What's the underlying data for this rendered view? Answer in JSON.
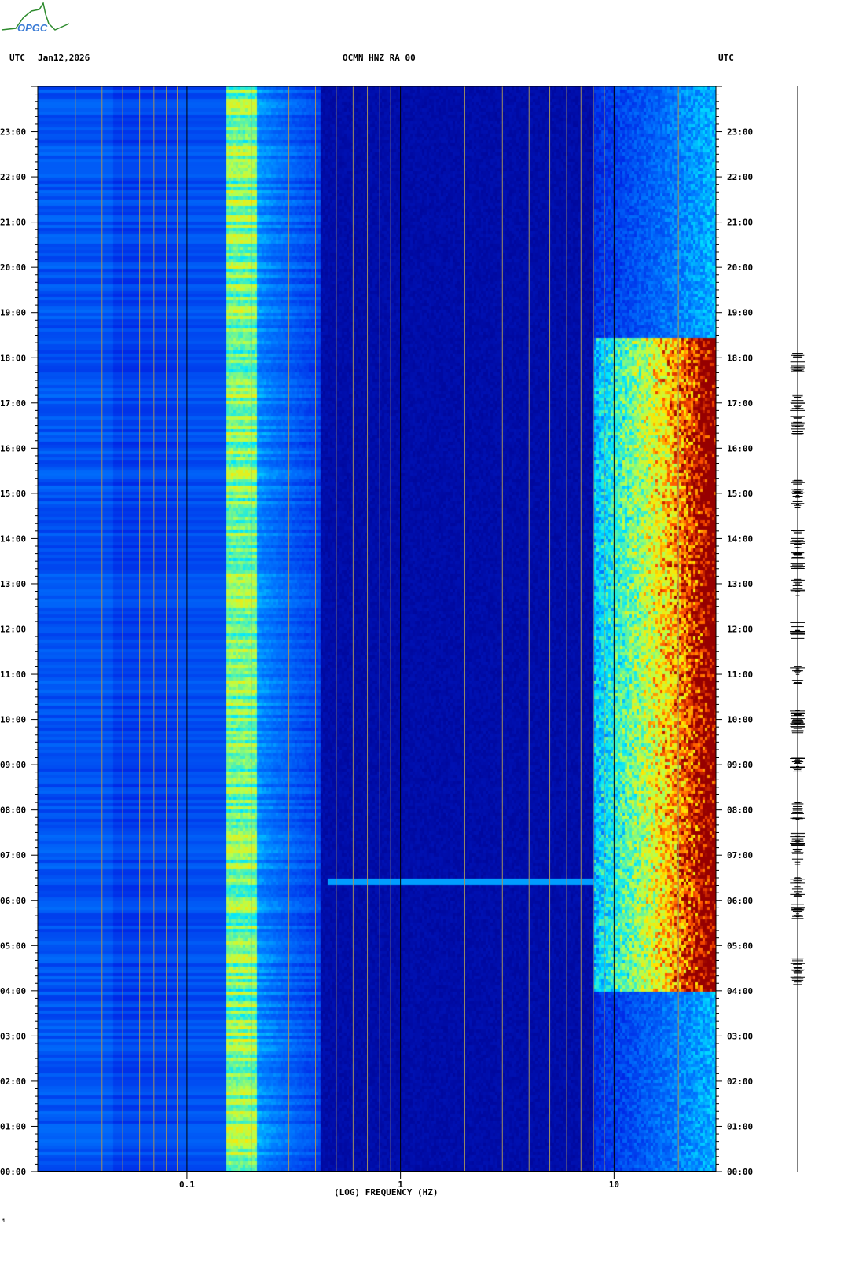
{
  "header": {
    "logo_text": "OPGC",
    "left_label": "UTC",
    "date": "Jan12,2026",
    "station": "OCMN HNZ RA 00",
    "right_label": "UTC"
  },
  "footer_mark": "M",
  "colors": {
    "low": "#00008c",
    "mid": "#0040ff",
    "cyan": "#00ffff",
    "yellow": "#ffff00",
    "red": "#a00000"
  },
  "chart_data": {
    "type": "heatmap",
    "title": "OCMN HNZ RA 00",
    "xlabel": "(LOG) FREQUENCY (HZ)",
    "ylabel": "UTC",
    "xscale": "log",
    "xlim": [
      0.02,
      30
    ],
    "ylim_hours": [
      0,
      24
    ],
    "xticks": [
      {
        "value": 0.1,
        "label": "0.1"
      },
      {
        "value": 1,
        "label": "1"
      },
      {
        "value": 10,
        "label": "10"
      }
    ],
    "yticks": [
      "00:00",
      "01:00",
      "02:00",
      "03:00",
      "04:00",
      "05:00",
      "06:00",
      "07:00",
      "08:00",
      "09:00",
      "10:00",
      "11:00",
      "12:00",
      "13:00",
      "14:00",
      "15:00",
      "16:00",
      "17:00",
      "18:00",
      "19:00",
      "20:00",
      "21:00",
      "22:00",
      "23:00"
    ],
    "features": [
      {
        "name": "microseism band",
        "freq_range_hz": [
          0.15,
          0.2
        ],
        "time_range_h": [
          0,
          24
        ],
        "level": "cyan-yellow"
      },
      {
        "name": "cultural noise",
        "freq_range_hz": [
          10,
          30
        ],
        "time_range_h": [
          4,
          18.5
        ],
        "level": "yellow-red"
      },
      {
        "name": "broadband line",
        "freq_range_hz": [
          0.5,
          30
        ],
        "time_h": 6.45,
        "level": "cyan"
      }
    ],
    "seismogram_event_hours": [
      4.3,
      4.6,
      5.8,
      6.3,
      7.0,
      7.3,
      8.0,
      9.0,
      9.9,
      10.0,
      11.0,
      12.0,
      12.9,
      13.5,
      14.0,
      14.9,
      15.1,
      16.5,
      17.0,
      17.9
    ]
  }
}
